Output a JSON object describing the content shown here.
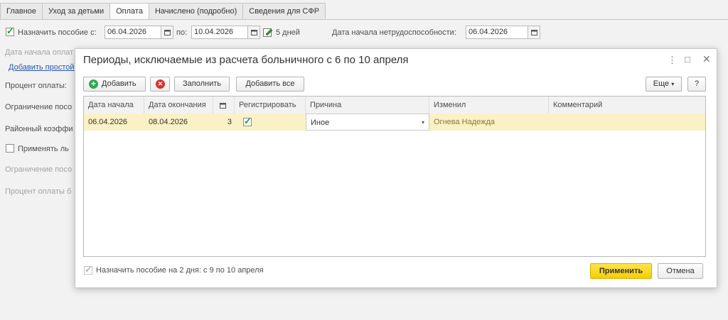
{
  "tabs": [
    {
      "label": "Главное",
      "active": false
    },
    {
      "label": "Уход за детьми",
      "active": false
    },
    {
      "label": "Оплата",
      "active": true
    },
    {
      "label": "Начислено (подробно)",
      "active": false
    },
    {
      "label": "Сведения для СФР",
      "active": false
    }
  ],
  "form": {
    "assign_benefit_label": "Назначить пособие  с:",
    "assign_benefit_checked": true,
    "date_from": "06.04.2026",
    "to_label": "по:",
    "date_to": "10.04.2026",
    "days_text": "5 дней",
    "incapacity_start_label": "Дата начала нетрудоспособности:",
    "incapacity_start_value": "06.04.2026",
    "payment_start_label": "Дата начала оплат",
    "add_downtime_link": "Добавить простой",
    "payment_percent_label": "Процент оплаты:",
    "benefit_limit_label": "Ограничение посо",
    "regional_coef_label": "Районный коэффи",
    "apply_benefits_label": "Применять ль",
    "limit2_label": "Ограничение посо",
    "payment_percent2_label": "Процент оплаты б"
  },
  "dialog": {
    "title": "Периоды, исключаемые из расчета больничного с 6 по 10 апреля",
    "toolbar": {
      "add": "Добавить",
      "fill": "Заполнить",
      "add_all": "Добавить все",
      "more": "Еще",
      "help": "?"
    },
    "columns": [
      "Дата начала",
      "Дата окончания",
      "",
      "Регистрировать",
      "Причина",
      "Изменил",
      "Комментарий"
    ],
    "rows": [
      {
        "start": "06.04.2026",
        "end": "08.04.2026",
        "days": "3",
        "register": true,
        "reason": "Иное",
        "changed_by": "Огнева Надежда",
        "comment": ""
      }
    ],
    "footer": {
      "assign_text": "Назначить пособие на 2 дня: с 9 по 10 апреля",
      "assign_checked": true,
      "apply": "Применить",
      "cancel": "Отмена"
    }
  },
  "colors": {
    "accent_yellow": "#f5cf00",
    "row_highlight": "#fbf1c6",
    "link": "#2357b2",
    "check": "#1e9e3a"
  }
}
